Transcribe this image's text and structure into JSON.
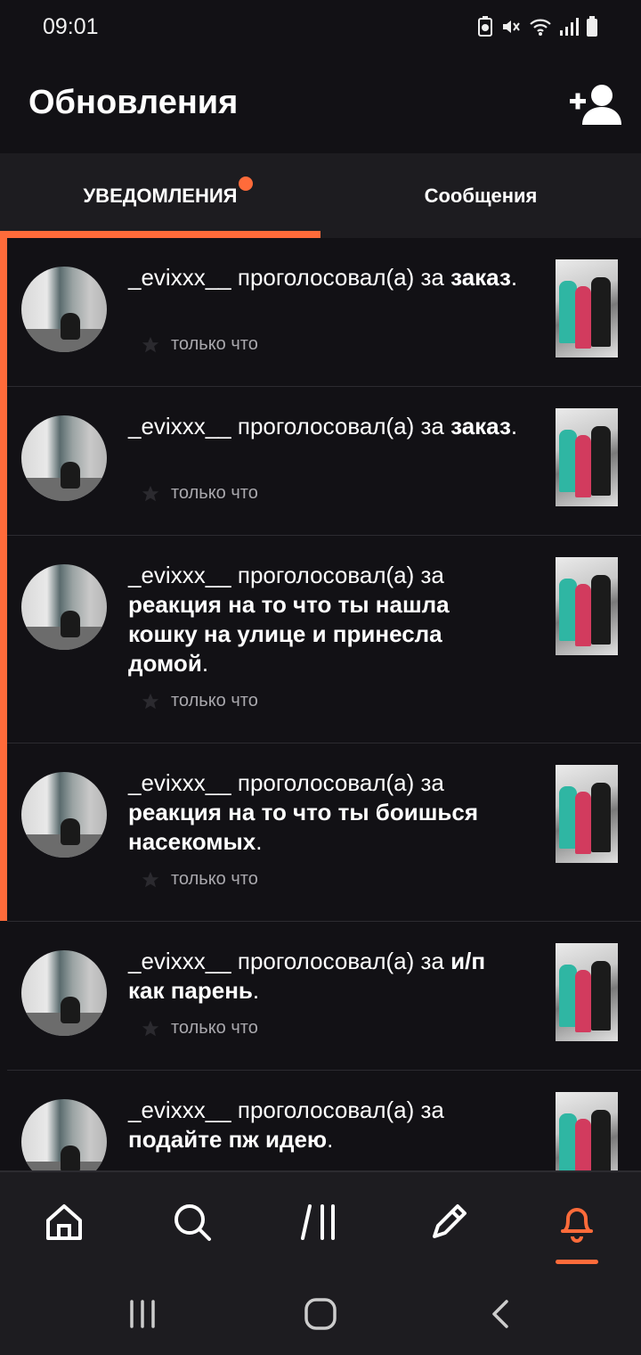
{
  "status_bar": {
    "time": "09:01"
  },
  "header": {
    "title": "Обновления"
  },
  "tabs": [
    {
      "label": "УВЕДОМЛЕНИЯ",
      "active": true,
      "has_dot": true
    },
    {
      "label": "Сообщения",
      "active": false,
      "has_dot": false
    }
  ],
  "notifications": [
    {
      "user": "_evixxx__",
      "verb": "проголосовал(а) за",
      "title": "заказ",
      "end": ".",
      "time": "только что",
      "unread": true
    },
    {
      "user": "_evixxx__",
      "verb": "проголосовал(а) за",
      "title": "заказ",
      "end": ".",
      "time": "только что",
      "unread": true
    },
    {
      "user": "_evixxx__",
      "verb": "проголосовал(а) за",
      "title": "реакция на то что ты нашла кошку на улице и принесла домой",
      "end": ".",
      "time": "только что",
      "unread": true
    },
    {
      "user": "_evixxx__",
      "verb": "проголосовал(а) за",
      "title": "реакция на то что ты боишься насекомых",
      "end": ".",
      "time": "только что",
      "unread": true
    },
    {
      "user": "_evixxx__",
      "verb": "проголосовал(а) за",
      "title": "и/п как парень",
      "end": ".",
      "time": "только что",
      "unread": false
    },
    {
      "user": "_evixxx__",
      "verb": "проголосовал(а) за",
      "title": "подайте пж идею",
      "end": ".",
      "time": "",
      "unread": false
    }
  ],
  "bottom_nav": {
    "items": [
      {
        "icon": "home-icon"
      },
      {
        "icon": "search-icon"
      },
      {
        "icon": "library-icon"
      },
      {
        "icon": "pencil-icon"
      },
      {
        "icon": "bell-icon",
        "active": true
      }
    ]
  },
  "colors": {
    "accent": "#ff6b3a",
    "background": "#121115",
    "surface": "#1d1c20",
    "muted_text": "#a9a8ad"
  }
}
